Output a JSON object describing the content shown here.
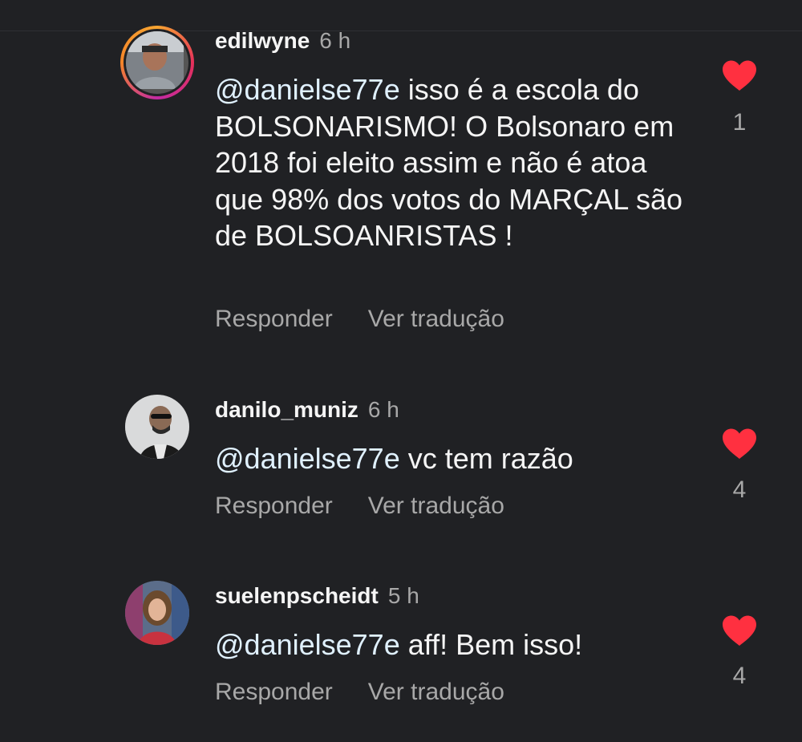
{
  "colors": {
    "background": "#202124",
    "heart": "#ff3040",
    "secondary": "#a8a8a8",
    "mention": "#e0f1ff"
  },
  "comments": [
    {
      "username": "edilwyne",
      "time": "6 h",
      "mention": "@danielse77e",
      "text": " isso é a escola do BOLSONARISMO! O Bolsonaro em 2018 foi eleito assim e não é atoa que 98% dos votos do MARÇAL são de BOLSOANRISTAS !",
      "reply_label": "Responder",
      "translate_label": "Ver tradução",
      "likes": "1",
      "has_story_ring": true
    },
    {
      "username": "danilo_muniz",
      "time": "6 h",
      "mention": "@danielse77e",
      "text": " vc tem razão",
      "reply_label": "Responder",
      "translate_label": "Ver tradução",
      "likes": "4",
      "has_story_ring": false
    },
    {
      "username": "suelenpscheidt",
      "time": "5 h",
      "mention": "@danielse77e",
      "text": " aff! Bem isso!",
      "reply_label": "Responder",
      "translate_label": "Ver tradução",
      "likes": "4",
      "has_story_ring": false
    }
  ]
}
